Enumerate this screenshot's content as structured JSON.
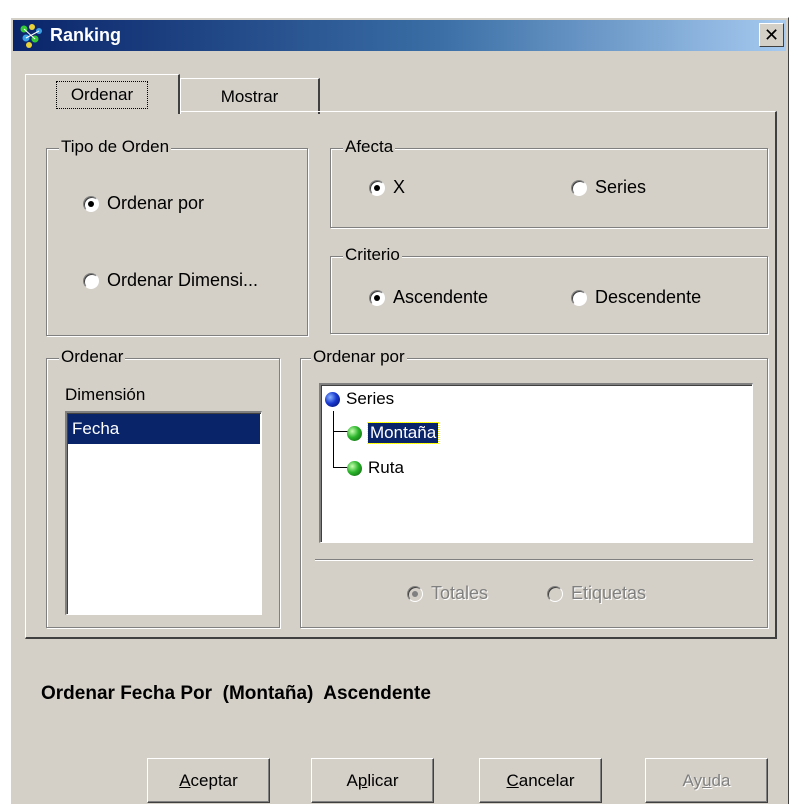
{
  "window": {
    "title": "Ranking",
    "close_icon": "close-icon"
  },
  "tabs": [
    {
      "label": "Ordenar",
      "active": true
    },
    {
      "label": "Mostrar",
      "active": false
    }
  ],
  "tipo_orden": {
    "title": "Tipo de Orden",
    "options": [
      {
        "label": "Ordenar por",
        "checked": true
      },
      {
        "label": "Ordenar Dimensi...",
        "checked": false
      }
    ]
  },
  "afecta": {
    "title": "Afecta",
    "options": [
      {
        "label": "X",
        "checked": true
      },
      {
        "label": "Series",
        "checked": false
      }
    ]
  },
  "criterio": {
    "title": "Criterio",
    "options": [
      {
        "label": "Ascendente",
        "checked": true
      },
      {
        "label": "Descendente",
        "checked": false
      }
    ]
  },
  "ordenar": {
    "title": "Ordenar",
    "header": "Dimensión",
    "items": [
      {
        "label": "Fecha",
        "selected": true
      }
    ]
  },
  "ordenar_por": {
    "title": "Ordenar por",
    "tree": {
      "root": "Series",
      "children": [
        {
          "label": "Montaña",
          "selected": true
        },
        {
          "label": "Ruta",
          "selected": false
        }
      ]
    },
    "options": [
      {
        "label": "Totales",
        "checked": true,
        "disabled": true
      },
      {
        "label": "Etiquetas",
        "checked": false,
        "disabled": true
      }
    ]
  },
  "status": "Ordenar Fecha Por  (Montaña)  Ascendente",
  "buttons": [
    {
      "pre": "",
      "mnemonic": "A",
      "post": "ceptar",
      "disabled": false
    },
    {
      "pre": "A",
      "mnemonic": "p",
      "post": "licar",
      "disabled": false
    },
    {
      "pre": "",
      "mnemonic": "C",
      "post": "ancelar",
      "disabled": false
    },
    {
      "pre": "Ay",
      "mnemonic": "u",
      "post": "da",
      "disabled": true
    }
  ],
  "colors": {
    "dialog_bg": "#d4d0c8",
    "selection": "#0a246a",
    "title_gradient_start": "#0a246a",
    "title_gradient_end": "#a6caf0"
  }
}
